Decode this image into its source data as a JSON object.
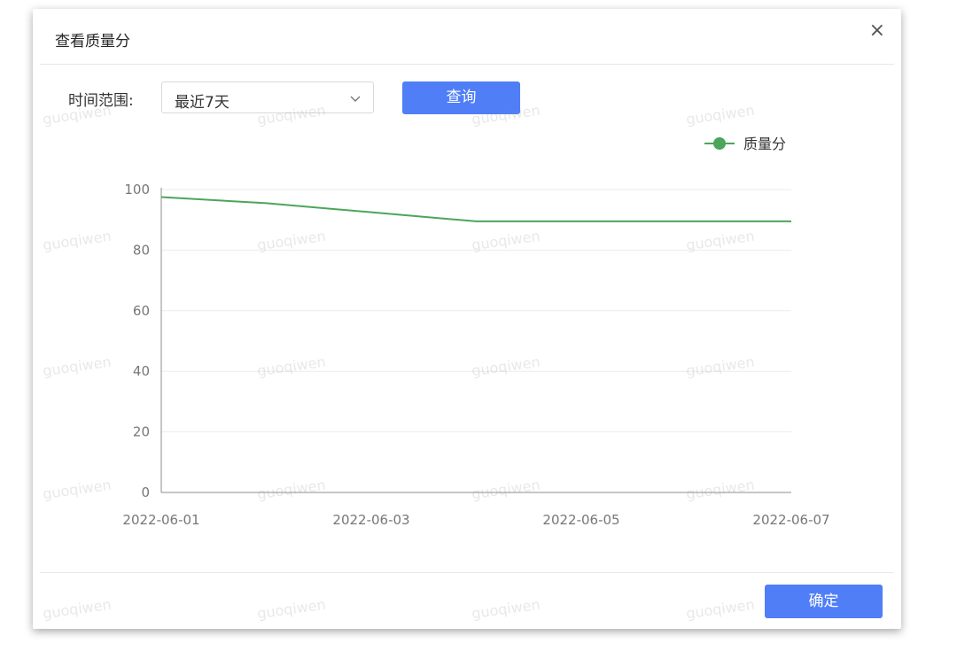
{
  "dialog": {
    "title": "查看质量分",
    "close_icon": "close-icon",
    "close_glyph": "×"
  },
  "filter": {
    "label": "时间范围:",
    "selected": "最近7天",
    "dropdown_icon": "chevron-down-icon",
    "query_label": "查询"
  },
  "footer": {
    "confirm_label": "确定"
  },
  "watermark": "guoqiwen",
  "colors": {
    "primary": "#4f7ef7",
    "series": "#4ca55a"
  },
  "chart_data": {
    "type": "line",
    "title": "",
    "xlabel": "",
    "ylabel": "",
    "x": [
      "2022-06-01",
      "2022-06-02",
      "2022-06-03",
      "2022-06-04",
      "2022-06-05",
      "2022-06-06",
      "2022-06-07"
    ],
    "x_tick_labels": [
      "2022-06-01",
      "2022-06-03",
      "2022-06-05",
      "2022-06-07"
    ],
    "ylim": [
      0,
      100
    ],
    "y_ticks": [
      0,
      20,
      40,
      60,
      80,
      100
    ],
    "grid": true,
    "legend_position": "top-right",
    "series": [
      {
        "name": "质量分",
        "values": [
          97.5,
          95.5,
          92.5,
          89.5,
          89.5,
          89.5,
          89.5
        ]
      }
    ]
  }
}
